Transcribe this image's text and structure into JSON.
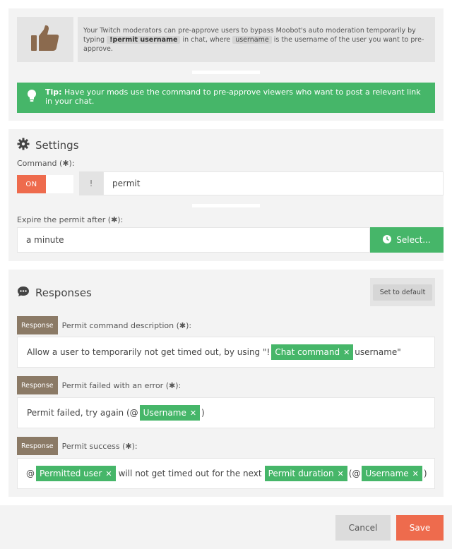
{
  "intro": {
    "icon": "thumbs-up-icon",
    "text_before": "Your Twitch moderators can pre-approve users to bypass Moobot's auto moderation temporarily by typing",
    "command_code": "!permit username",
    "text_middle": "in chat, where",
    "username_code": "username",
    "text_after": "is the username of the user you want to pre-approve."
  },
  "tip": {
    "icon": "lightbulb-icon",
    "label": "Tip:",
    "text": "Have your mods use the command to pre-approve viewers who want to post a relevant link in your chat."
  },
  "settings": {
    "title": "Settings",
    "icon": "gear-icon",
    "command_label": "Command (",
    "required_mark": "✱",
    "label_close": "):",
    "toggle_label": "ON",
    "prefix": "!",
    "command_value": "permit"
  },
  "expire": {
    "label": "Expire the permit after (",
    "value": "a minute",
    "select_label": "Select...",
    "select_icon": "clock-icon"
  },
  "responses": {
    "title": "Responses",
    "icon": "speech-bubble-icon",
    "default_button": "Set to default",
    "tag": "Response",
    "items": [
      {
        "label": "Permit command description (",
        "parts": [
          "Allow a user to temporarily not get timed out, by using \"!",
          "Chat command",
          "username\""
        ]
      },
      {
        "label": "Permit failed with an error (",
        "parts": [
          "Permit failed, try again (@",
          "Username",
          ")"
        ]
      },
      {
        "label": "Permit success (",
        "parts": [
          "@",
          "Permitted user",
          "will not get timed out for the next",
          "Permit duration",
          "(@",
          "Username",
          ")"
        ]
      }
    ]
  },
  "footer": {
    "cancel_label": "Cancel",
    "save_label": "Save"
  },
  "colors": {
    "accent_green": "#46b669",
    "accent_orange": "#ee6b4d",
    "response_tag": "#8b7a66"
  }
}
